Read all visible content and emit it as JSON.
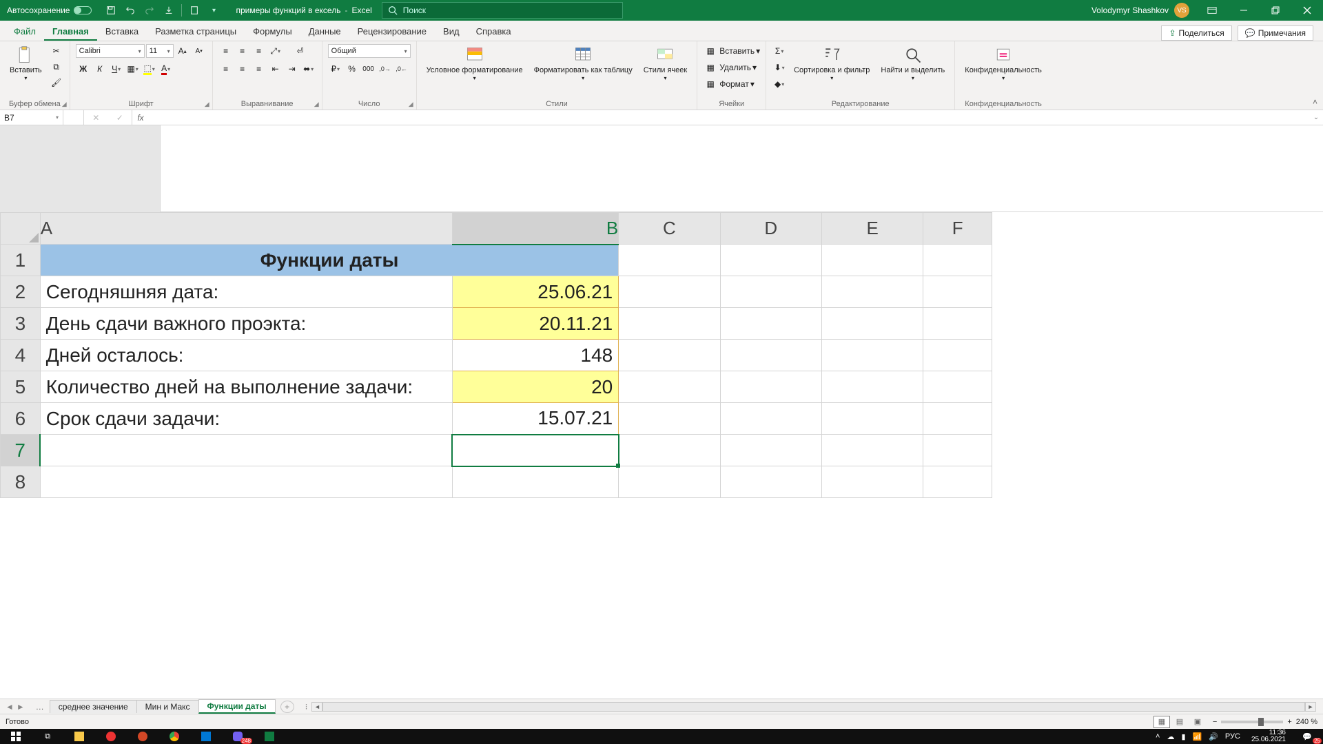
{
  "titleBar": {
    "autosave": "Автосохранение",
    "docTitle": "примеры функций в ексель",
    "appName": "Excel",
    "searchPlaceholder": "Поиск",
    "userName": "Volodymyr Shashkov",
    "userInitials": "VS"
  },
  "ribbonTabs": {
    "file": "Файл",
    "home": "Главная",
    "insert": "Вставка",
    "layout": "Разметка страницы",
    "formulas": "Формулы",
    "data": "Данные",
    "review": "Рецензирование",
    "view": "Вид",
    "help": "Справка",
    "share": "Поделиться",
    "comments": "Примечания"
  },
  "ribbon": {
    "clipboard": {
      "paste": "Вставить",
      "label": "Буфер обмена"
    },
    "font": {
      "name": "Calibri",
      "size": "11",
      "label": "Шрифт",
      "bold": "Ж",
      "italic": "К",
      "underline": "Ч"
    },
    "alignment": {
      "label": "Выравнивание"
    },
    "number": {
      "format": "Общий",
      "label": "Число"
    },
    "styles": {
      "cond": "Условное форматирование",
      "table": "Форматировать как таблицу",
      "cell": "Стили ячеек",
      "label": "Стили"
    },
    "cells": {
      "insert": "Вставить",
      "delete": "Удалить",
      "format": "Формат",
      "label": "Ячейки"
    },
    "editing": {
      "sort": "Сортировка и фильтр",
      "find": "Найти и выделить",
      "label": "Редактирование"
    },
    "sensitivity": {
      "btn": "Конфиденциальность",
      "label": "Конфиденциальность"
    }
  },
  "nameBox": "B7",
  "columns": {
    "A": "A",
    "B": "B",
    "C": "C",
    "D": "D",
    "E": "E",
    "F": "F"
  },
  "rows": {
    "r1": {
      "num": "1",
      "title": "Функции даты"
    },
    "r2": {
      "num": "2",
      "a": "Сегодняшняя дата:",
      "b": "25.06.21"
    },
    "r3": {
      "num": "3",
      "a": "День сдачи важного проэкта:",
      "b": "20.11.21"
    },
    "r4": {
      "num": "4",
      "a": "Дней осталось:",
      "b": "148"
    },
    "r5": {
      "num": "5",
      "a": "Количество дней на выполнение задачи:",
      "b": "20"
    },
    "r6": {
      "num": "6",
      "a": "Срок сдачи задачи:",
      "b": "15.07.21"
    },
    "r7": {
      "num": "7"
    },
    "r8": {
      "num": "8"
    }
  },
  "sheetTabs": {
    "dots": "…",
    "s1": "среднее значение",
    "s2": "Мин и Макс",
    "s3": "Функции даты"
  },
  "statusBar": {
    "ready": "Готово",
    "zoom": "240 %"
  },
  "taskbar": {
    "lang": "РУС",
    "time": "11:36",
    "date": "25.06.2021",
    "viberBadge": "248",
    "notifBadge": "25"
  }
}
